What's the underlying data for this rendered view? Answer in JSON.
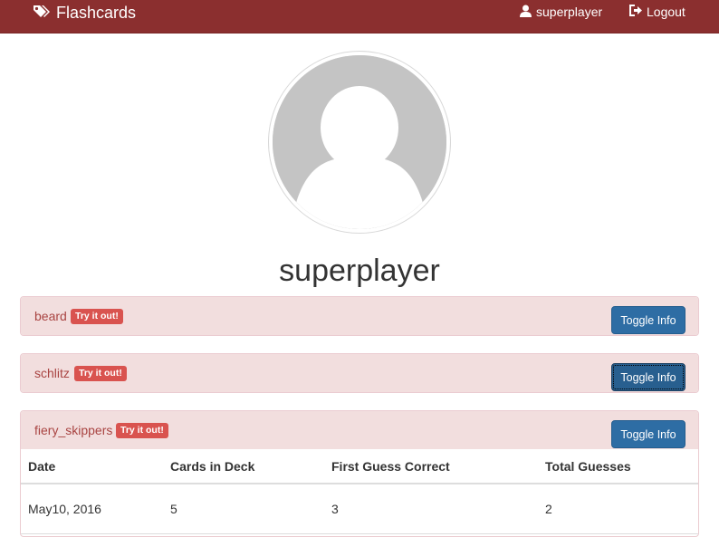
{
  "navbar": {
    "brand": "Flashcards",
    "user_label": "superplayer",
    "logout_label": "Logout",
    "background": "#8b2f2f"
  },
  "profile": {
    "username": "superplayer"
  },
  "decks": [
    {
      "name": "beard",
      "tag": "Try it out!",
      "button": "Toggle Info"
    },
    {
      "name": "schlitz",
      "tag": "Try it out!",
      "button": "Toggle Info"
    },
    {
      "name": "fiery_skippers",
      "tag": "Try it out!",
      "button": "Toggle Info"
    }
  ],
  "stats_table": {
    "columns": [
      "Date",
      "Cards in Deck",
      "First Guess Correct",
      "Total Guesses"
    ],
    "rows": [
      [
        "May10, 2016",
        "5",
        "3",
        "2"
      ]
    ]
  },
  "colors": {
    "panel_bg": "#f2dede",
    "panel_text": "#a94442",
    "tag_bg": "#d9534f",
    "button_bg": "#2e6da4"
  }
}
